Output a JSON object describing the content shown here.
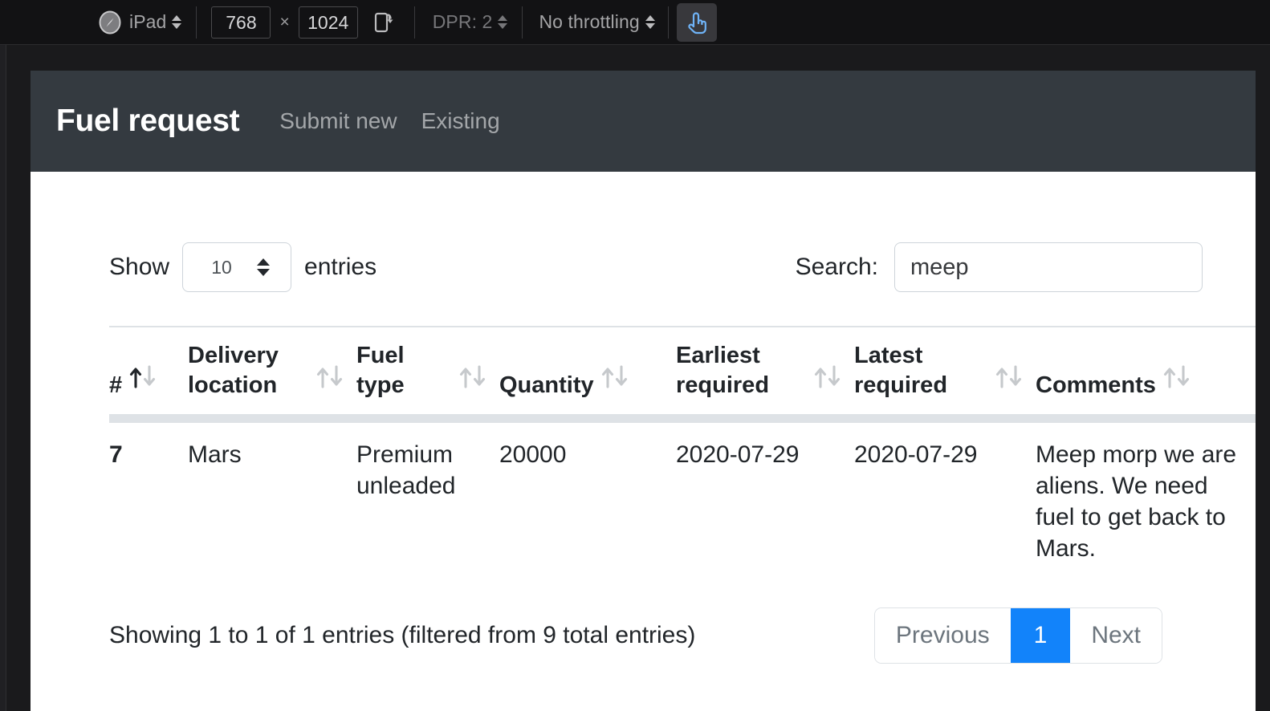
{
  "devtools": {
    "device_icon": "compass-icon",
    "device_name": "iPad",
    "width": "768",
    "times": "×",
    "height": "1024",
    "rotate_icon": "rotate-device-icon",
    "dpr_label": "DPR: 2",
    "throttling_label": "No throttling",
    "touch_icon": "touch-cursor-icon"
  },
  "navbar": {
    "brand": "Fuel request",
    "links": [
      {
        "label": "Submit new"
      },
      {
        "label": "Existing"
      }
    ]
  },
  "datatable": {
    "length_label_before": "Show",
    "length_value": "10",
    "length_label_after": "entries",
    "search_label": "Search:",
    "search_value": "meep",
    "search_placeholder": "",
    "columns": [
      {
        "label": "#",
        "sort": "asc"
      },
      {
        "label": "Delivery location",
        "sort": "none"
      },
      {
        "label": "Fuel type",
        "sort": "none"
      },
      {
        "label": "Quantity",
        "sort": "none"
      },
      {
        "label": "Earliest required",
        "sort": "none"
      },
      {
        "label": "Latest required",
        "sort": "none"
      },
      {
        "label": "Comments",
        "sort": "none"
      }
    ],
    "rows": [
      {
        "num": "7",
        "location": "Mars",
        "fuel_type": "Premium unleaded",
        "quantity": "20000",
        "earliest": "2020-07-29",
        "latest": "2020-07-29",
        "comments": "Meep morp we are aliens. We need fuel to get back to Mars."
      }
    ],
    "info": "Showing 1 to 1 of 1 entries (filtered from 9 total entries)",
    "pagination": {
      "previous": "Previous",
      "page_1": "1",
      "next": "Next"
    }
  },
  "colors": {
    "navbar_bg": "#343a40",
    "accent_blue": "#1283fa",
    "border": "#dee2e6",
    "muted_text": "#6c757d",
    "body_text": "#212529"
  }
}
